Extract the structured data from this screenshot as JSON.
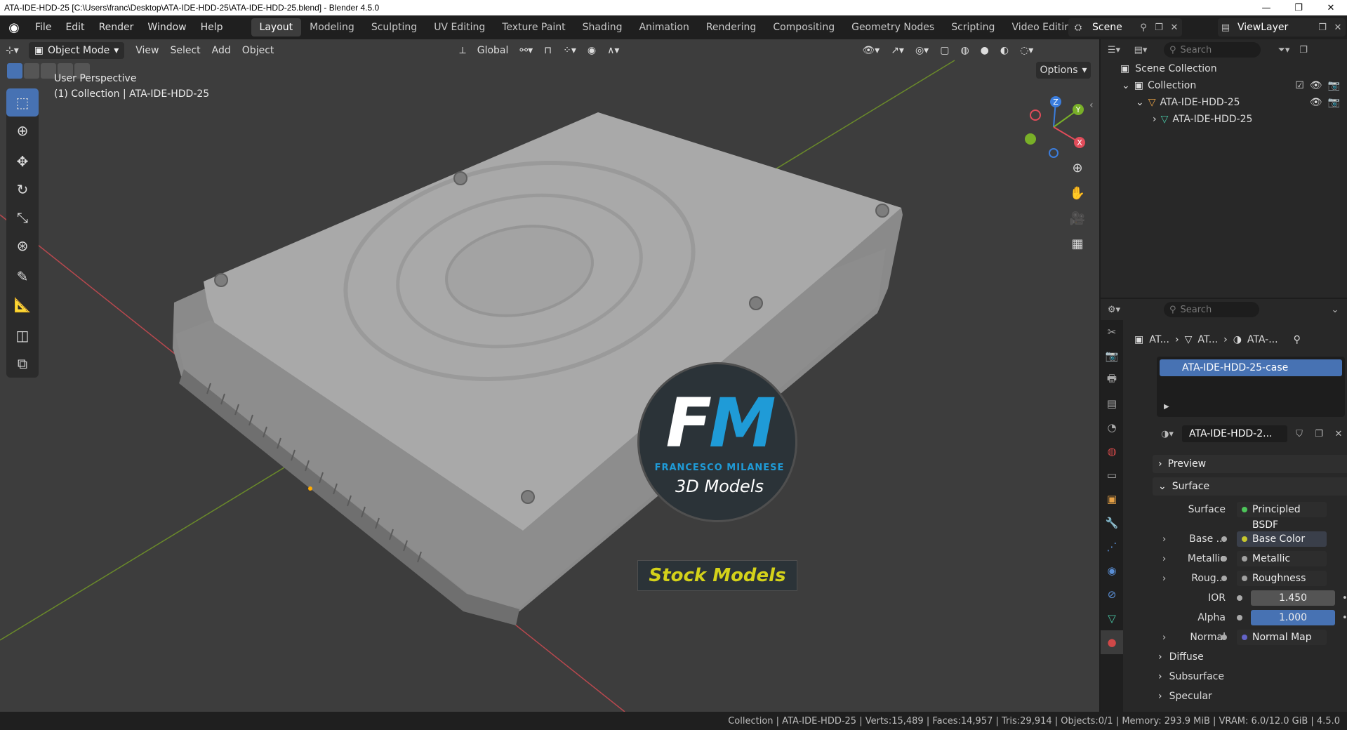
{
  "window": {
    "title": "ATA-IDE-HDD-25 [C:\\Users\\franc\\Desktop\\ATA-IDE-HDD-25\\ATA-IDE-HDD-25.blend] - Blender 4.5.0"
  },
  "menu": [
    "File",
    "Edit",
    "Render",
    "Window",
    "Help"
  ],
  "workspaces": [
    "Layout",
    "Modeling",
    "Sculpting",
    "UV Editing",
    "Texture Paint",
    "Shading",
    "Animation",
    "Rendering",
    "Compositing",
    "Geometry Nodes",
    "Scripting",
    "Video Editing"
  ],
  "scene": "Scene",
  "view_layer": "ViewLayer",
  "viewport": {
    "mode": "Object Mode",
    "menus": [
      "View",
      "Select",
      "Add",
      "Object"
    ],
    "orientation": "Global",
    "options_label": "Options",
    "perspective_label": "User Perspective",
    "collection_label": "(1) Collection | ATA-IDE-HDD-25"
  },
  "gizmo": {
    "z": "Z",
    "y": "Y",
    "x": "X"
  },
  "logo": {
    "f": "F",
    "m": "M",
    "subtitle": "FRANCESCO MILANESE",
    "models": "3D Models",
    "stock": "Stock Models"
  },
  "outliner": {
    "search_placeholder": "Search",
    "scene_collection": "Scene Collection",
    "collection": "Collection",
    "object": "ATA-IDE-HDD-25",
    "mesh": "ATA-IDE-HDD-25"
  },
  "properties": {
    "search_placeholder": "Search",
    "breadcrumb": [
      "AT...",
      "AT...",
      "ATA-..."
    ],
    "material_slot": "ATA-IDE-HDD-25-case",
    "material_name": "ATA-IDE-HDD-2...",
    "panels": {
      "preview": "Preview",
      "surface": "Surface"
    },
    "surface_label": "Surface",
    "surface_value": "Principled BSDF",
    "rows": [
      {
        "label": "Base ...",
        "value": "Base Color",
        "color": "#c7c72e"
      },
      {
        "label": "Metallic",
        "value": "Metallic",
        "color": "#a1a1a1"
      },
      {
        "label": "Roug...",
        "value": "Roughness",
        "color": "#a1a1a1"
      }
    ],
    "ior_label": "IOR",
    "ior_value": "1.450",
    "alpha_label": "Alpha",
    "alpha_value": "1.000",
    "normal_label": "Normal",
    "normal_value": "Normal Map",
    "subpanels": [
      "Diffuse",
      "Subsurface",
      "Specular"
    ]
  },
  "statusbar": "Collection | ATA-IDE-HDD-25 | Verts:15,489 | Faces:14,957 | Tris:29,914 | Objects:0/1 | Memory: 293.9 MiB | VRAM: 6.0/12.0 GiB | 4.5.0"
}
